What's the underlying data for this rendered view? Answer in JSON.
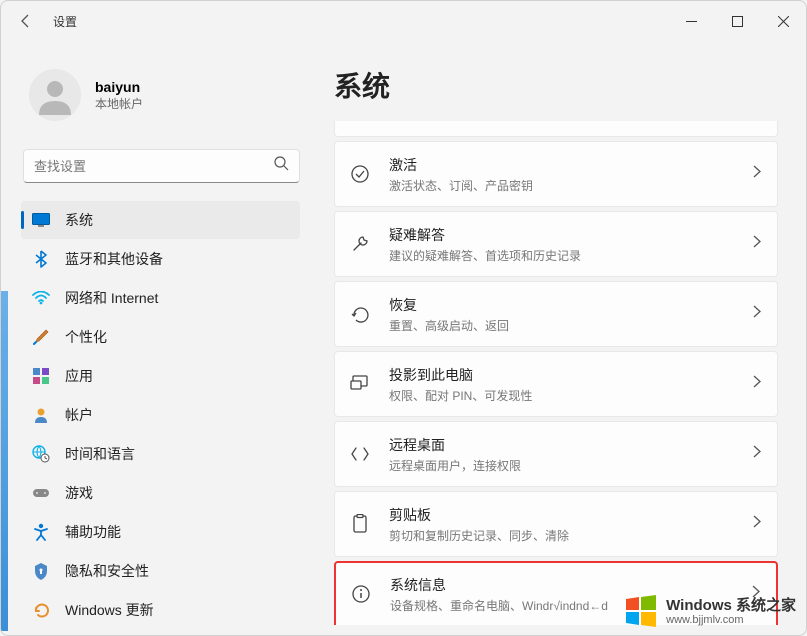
{
  "titlebar": {
    "title": "设置"
  },
  "user": {
    "name": "baiyun",
    "subtitle": "本地帐户"
  },
  "search": {
    "placeholder": "查找设置"
  },
  "sidebar": {
    "items": [
      {
        "label": "系统"
      },
      {
        "label": "蓝牙和其他设备"
      },
      {
        "label": "网络和 Internet"
      },
      {
        "label": "个性化"
      },
      {
        "label": "应用"
      },
      {
        "label": "帐户"
      },
      {
        "label": "时间和语言"
      },
      {
        "label": "游戏"
      },
      {
        "label": "辅助功能"
      },
      {
        "label": "隐私和安全性"
      },
      {
        "label": "Windows 更新"
      }
    ]
  },
  "main": {
    "title": "系统",
    "cards": [
      {
        "title": "激活",
        "subtitle": "激活状态、订阅、产品密钥"
      },
      {
        "title": "疑难解答",
        "subtitle": "建议的疑难解答、首选项和历史记录"
      },
      {
        "title": "恢复",
        "subtitle": "重置、高级启动、返回"
      },
      {
        "title": "投影到此电脑",
        "subtitle": "权限、配对 PIN、可发现性"
      },
      {
        "title": "远程桌面",
        "subtitle": "远程桌面用户，连接权限"
      },
      {
        "title": "剪贴板",
        "subtitle": "剪切和复制历史记录、同步、清除"
      },
      {
        "title": "系统信息",
        "subtitle": "设备规格、重命名电脑、Windr√indnd←d"
      }
    ]
  },
  "watermark": {
    "brand": "Windows 系统之家",
    "url": "www.bjjmlv.com"
  }
}
